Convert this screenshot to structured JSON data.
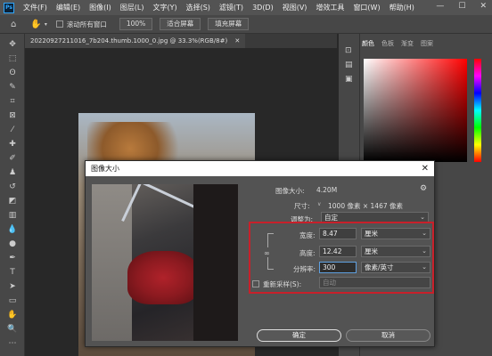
{
  "menubar": {
    "logo": "Ps",
    "items": [
      "文件(F)",
      "编辑(E)",
      "图像(I)",
      "图层(L)",
      "文字(Y)",
      "选择(S)",
      "滤镜(T)",
      "3D(D)",
      "视图(V)",
      "增效工具",
      "窗口(W)",
      "帮助(H)"
    ],
    "min": "—",
    "max": "☐",
    "close": "✕"
  },
  "options": {
    "scroll_all": "滚动所有窗口",
    "zoom": "100%",
    "fit": "适合屏幕",
    "fill": "填充屏幕"
  },
  "document": {
    "tab_title": "20220927211016_7b204.thumb.1000_0.jpg @ 33.3%(RGB/8#)",
    "tab_close": "✕"
  },
  "color_panel": {
    "tabs": [
      "颜色",
      "色板",
      "渐变",
      "图案"
    ]
  },
  "dialog": {
    "title": "图像大小",
    "close": "✕",
    "image_size_label": "图像大小:",
    "image_size_value": "4.20M",
    "dimensions_label": "尺寸:",
    "dimensions_value": "1000 像素 × 1467 像素",
    "fit_to_label": "调整为:",
    "fit_to_value": "自定",
    "width_label": "宽度:",
    "width_value": "8.47",
    "width_unit": "厘米",
    "height_label": "高度:",
    "height_value": "12.42",
    "height_unit": "厘米",
    "resolution_label": "分辨率:",
    "resolution_value": "300",
    "resolution_unit": "像素/英寸",
    "resample_label": "重新采样(S):",
    "resample_value": "自动",
    "ok": "确定",
    "cancel": "取消"
  },
  "colors": {
    "accent": "#c8202a",
    "focus": "#5fa0e0"
  }
}
